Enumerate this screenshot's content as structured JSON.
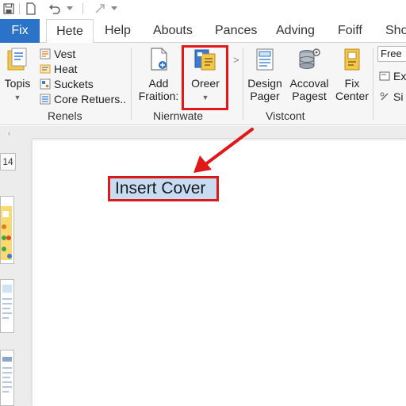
{
  "qat": {
    "icons": [
      "save-icon",
      "document-icon",
      "undo-icon",
      "dropdown-icon",
      "redo-icon",
      "customize-icon"
    ]
  },
  "tabs": {
    "file": "Fix",
    "items": [
      "Hete",
      "Help",
      "Abouts",
      "Pances",
      "Adving",
      "Foiff",
      "Sho"
    ]
  },
  "ribbon": {
    "group1": {
      "big_label": "Topis",
      "items": [
        "Vest",
        "Heat",
        "Suckets",
        "Core Retuers.."
      ],
      "label": "Renels"
    },
    "group2": {
      "add_line1": "Add",
      "add_line2": "Fraition:",
      "cover_label": "Oreer",
      "label": "Niernwate"
    },
    "group3": {
      "design_line1": "Design",
      "design_line2": "Pager",
      "accoval_line1": "Accoval",
      "accoval_line2": "Pagest",
      "fix_line1": "Fix",
      "fix_line2": "Center",
      "label": "Vistcont"
    },
    "group4": {
      "dropdown_value": "Free",
      "items": [
        "Ex",
        "Si"
      ]
    }
  },
  "leftpane": {
    "page_number": "14"
  },
  "callout": {
    "text": "Insert Cover"
  },
  "colors": {
    "accent": "#2b73c9",
    "highlight_red": "#e01818",
    "callout_bg": "#c7dcf3"
  }
}
